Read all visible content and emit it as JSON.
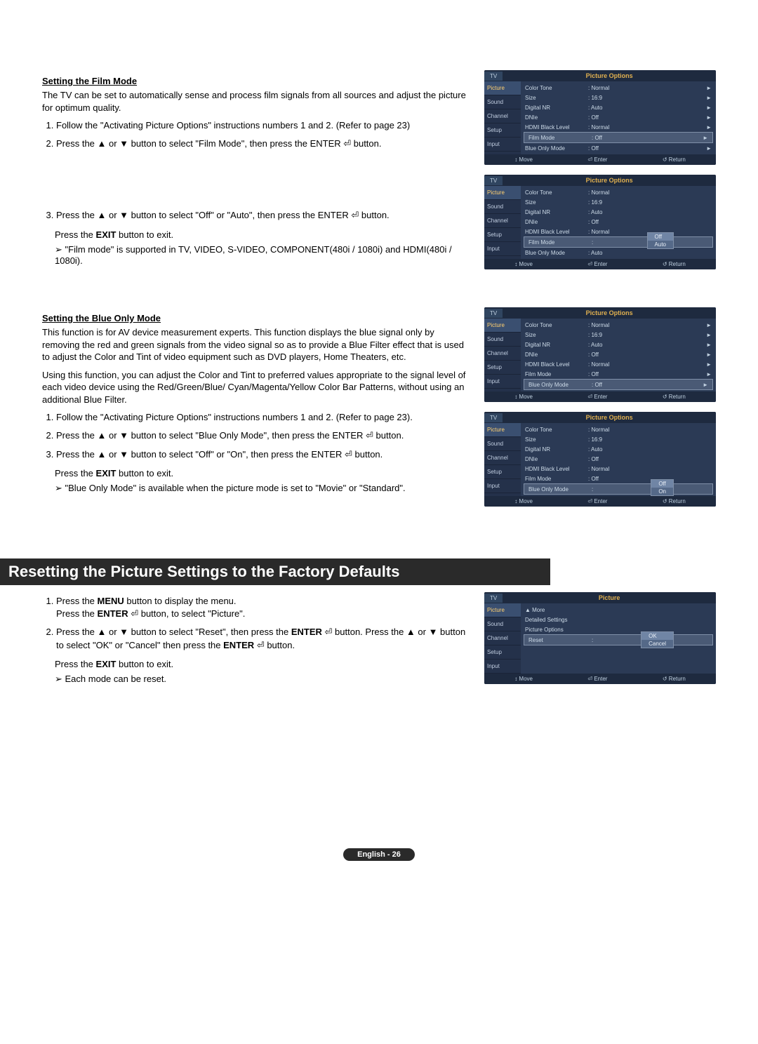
{
  "section1": {
    "title": "Setting the Film Mode",
    "intro": "The TV can be set to automatically sense and process film signals from all sources and adjust the picture for optimum quality.",
    "steps": [
      "Follow the \"Activating Picture Options\" instructions numbers 1 and 2. (Refer to page 23)",
      "Press the ▲ or ▼ button to select \"Film Mode\", then press the ENTER ⏎ button.",
      "Press the ▲ or ▼ button to select \"Off\" or \"Auto\", then press the ENTER ⏎ button."
    ],
    "exit_note": "Press the EXIT button to exit.",
    "arrow_note": "\"Film mode\" is supported in TV, VIDEO, S-VIDEO, COMPONENT(480i / 1080i) and HDMI(480i / 1080i)."
  },
  "section2": {
    "title": "Setting the Blue Only Mode",
    "intro1": "This function is for AV device measurement experts. This function displays the blue signal only by removing the red and green signals from the video signal so as to provide a Blue Filter effect that is used to adjust the Color and Tint of video equipment such as DVD players, Home Theaters, etc.",
    "intro2": "Using this function, you can adjust the Color and Tint to preferred values appropriate to the signal level of each video device using the Red/Green/Blue/ Cyan/Magenta/Yellow Color Bar Patterns, without using an additional Blue Filter.",
    "steps": [
      "Follow the \"Activating Picture Options\" instructions numbers 1 and 2. (Refer to page 23).",
      "Press the ▲ or ▼ button to select \"Blue Only Mode\", then press the ENTER ⏎ button.",
      "Press the ▲ or ▼ button to select \"Off\" or \"On\", then press the ENTER ⏎ button."
    ],
    "exit_note": "Press the EXIT button to exit.",
    "arrow_note": "\"Blue Only Mode\" is available when the picture mode is set to \"Movie\" or \"Standard\"."
  },
  "section3": {
    "heading": "Resetting the Picture Settings to the Factory Defaults",
    "steps": [
      "Press the MENU button to display the menu. Press the ENTER ⏎ button, to select \"Picture\".",
      "Press the ▲ or ▼ button to select \"Reset\", then press the ENTER ⏎ button. Press the ▲ or ▼ button to select \"OK\" or \"Cancel\" then press the ENTER ⏎ button."
    ],
    "exit_note": "Press the EXIT button to exit.",
    "arrow_note": "Each mode can be reset."
  },
  "osd": {
    "tv": "TV",
    "title_po": "Picture Options",
    "title_picture": "Picture",
    "side": [
      "Picture",
      "Sound",
      "Channel",
      "Setup",
      "Input"
    ],
    "rows_po": [
      {
        "label": "Color Tone",
        "value": ": Normal"
      },
      {
        "label": "Size",
        "value": ": 16:9"
      },
      {
        "label": "Digital NR",
        "value": ": Auto"
      },
      {
        "label": "DNIe",
        "value": ": Off"
      },
      {
        "label": "HDMI Black Level",
        "value": ": Normal"
      },
      {
        "label": "Film Mode",
        "value": ": Off"
      },
      {
        "label": "Blue Only Mode",
        "value": ": Off"
      }
    ],
    "film_dropdown": [
      "Off",
      "Auto"
    ],
    "blue_dropdown": [
      "Off",
      "On"
    ],
    "reset_rows": [
      "▲ More",
      "Detailed Settings",
      "Picture Options",
      "Reset"
    ],
    "reset_dropdown": [
      "OK",
      "Cancel"
    ],
    "footer": {
      "move": "Move",
      "enter": "Enter",
      "return": "Return"
    }
  },
  "page_footer": "English - 26"
}
